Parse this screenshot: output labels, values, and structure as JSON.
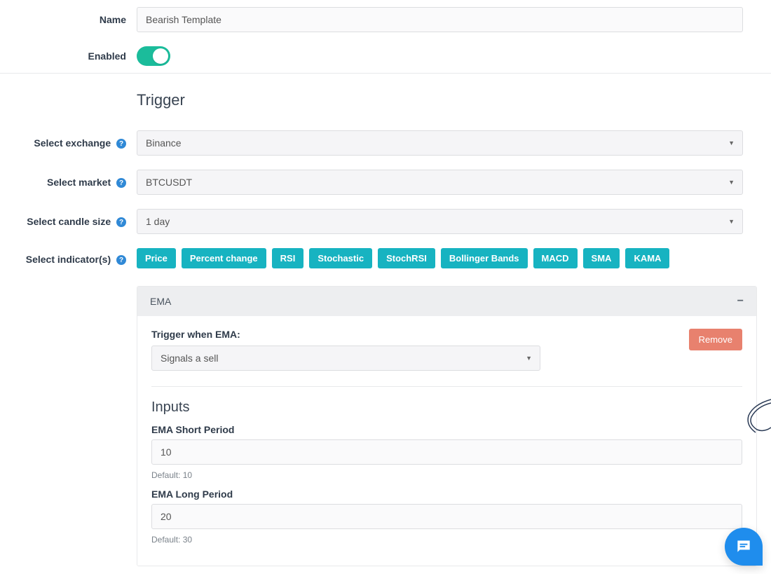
{
  "labels": {
    "name": "Name",
    "enabled": "Enabled",
    "exchange": "Select exchange",
    "market": "Select market",
    "candle": "Select candle size",
    "indicators": "Select indicator(s)"
  },
  "values": {
    "name": "Bearish Template",
    "exchange": "Binance",
    "market": "BTCUSDT",
    "candle": "1 day"
  },
  "section": {
    "trigger": "Trigger"
  },
  "indicators": [
    "Price",
    "Percent change",
    "RSI",
    "Stochastic",
    "StochRSI",
    "Bollinger Bands",
    "MACD",
    "SMA",
    "KAMA"
  ],
  "panel": {
    "title": "EMA",
    "trigger_label": "Trigger when EMA:",
    "trigger_value": "Signals a sell",
    "remove": "Remove",
    "inputs_heading": "Inputs",
    "short": {
      "label": "EMA Short Period",
      "value": "10",
      "hint": "Default: 10"
    },
    "long": {
      "label": "EMA Long Period",
      "value": "20",
      "hint": "Default: 30"
    }
  }
}
